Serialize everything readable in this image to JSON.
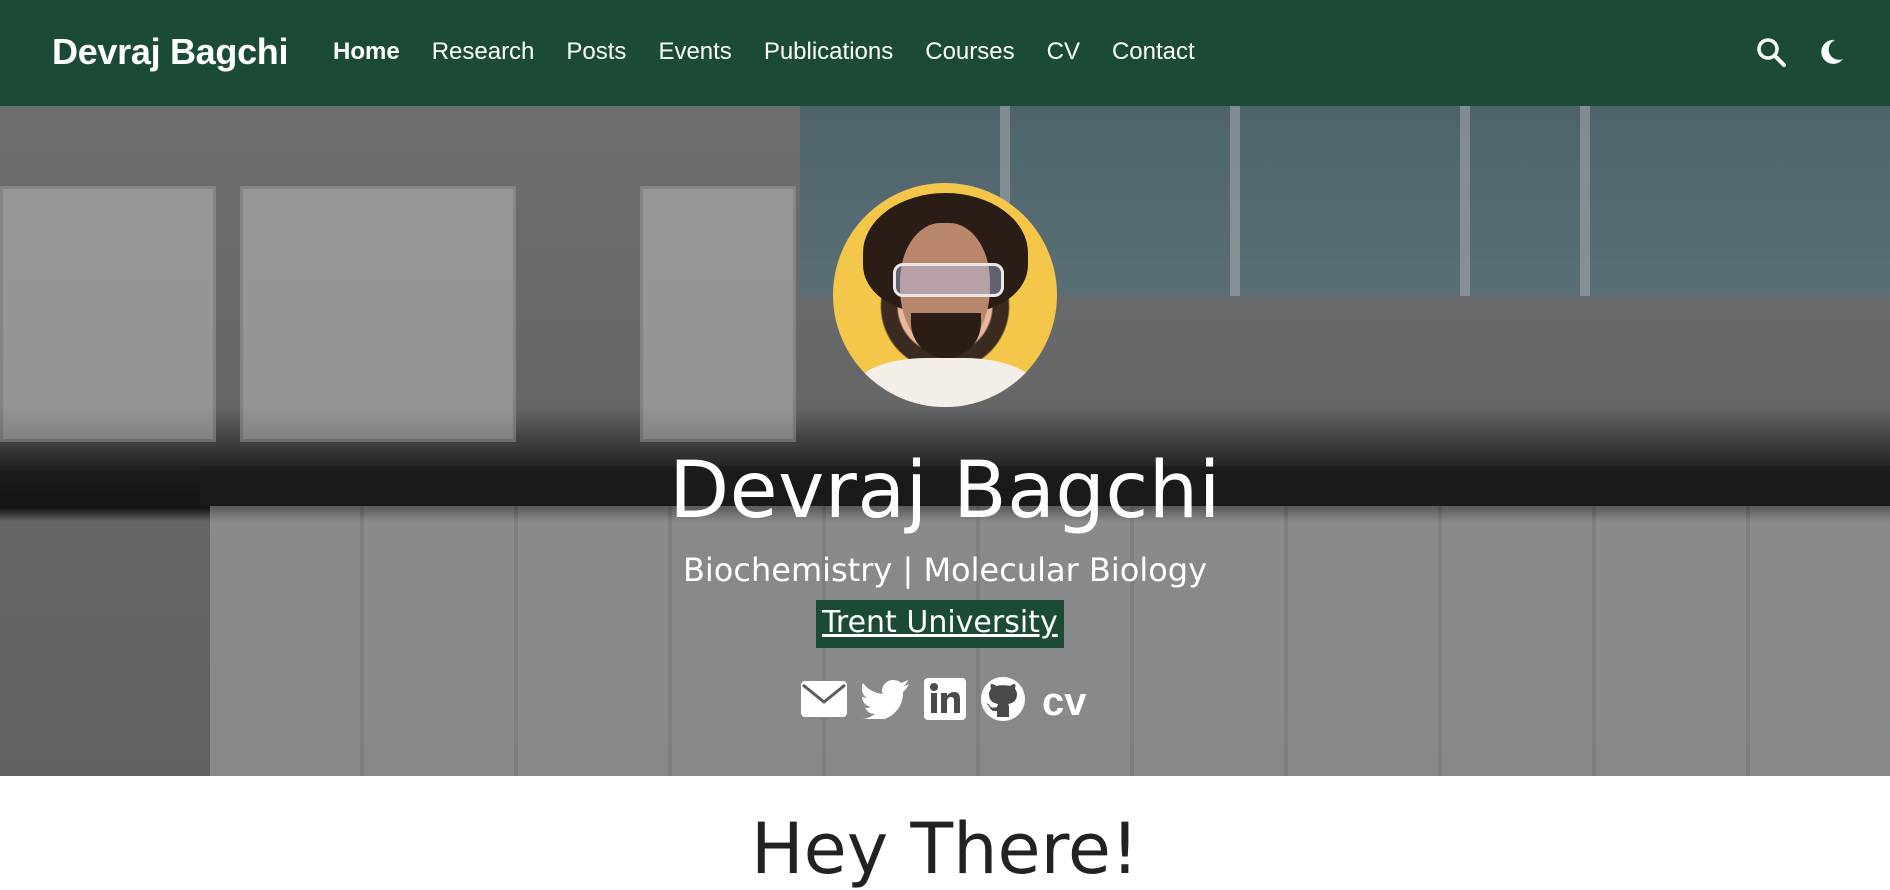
{
  "navbar": {
    "brand": "Devraj Bagchi",
    "items": [
      {
        "label": "Home",
        "active": true
      },
      {
        "label": "Research",
        "active": false
      },
      {
        "label": "Posts",
        "active": false
      },
      {
        "label": "Events",
        "active": false
      },
      {
        "label": "Publications",
        "active": false
      },
      {
        "label": "Courses",
        "active": false
      },
      {
        "label": "CV",
        "active": false
      },
      {
        "label": "Contact",
        "active": false
      }
    ],
    "icons": [
      "search-icon",
      "dark-mode-moon-icon"
    ]
  },
  "hero": {
    "name": "Devraj Bagchi",
    "subtitle": "Biochemistry | Molecular Biology",
    "organization": "Trent University",
    "social_icons": [
      "envelope-icon",
      "twitter-icon",
      "linkedin-icon",
      "github-icon",
      "cv-icon"
    ],
    "cv_text": "cv"
  },
  "content": {
    "heading": "Hey There!"
  },
  "colors": {
    "navbar_bg": "#1b4b34",
    "org_highlight": "#1b4b34",
    "text_light": "#ffffff"
  }
}
